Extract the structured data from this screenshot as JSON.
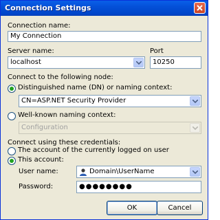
{
  "window": {
    "title": "Connection Settings"
  },
  "connection_name": {
    "label": "Connection name:",
    "value": "My Connection"
  },
  "server": {
    "label": "Server name:",
    "value": "localhost"
  },
  "port": {
    "label": "Port",
    "value": "10250"
  },
  "node": {
    "label": "Connect to the following node:",
    "dn_label": "Distinguished name (DN) or naming context:",
    "dn_value": "CN=ASP.NET Security Provider",
    "wk_label": "Well-known naming context:",
    "wk_value": "Configuration"
  },
  "credentials": {
    "label": "Connect using these credentials:",
    "current_user_label": "The account of the currently logged on user",
    "this_account_label": "This account:",
    "user_name_label": "User name:",
    "user_name_value": "Domain\\UserName",
    "password_label": "Password:",
    "password_value": "●●●●●●●●"
  },
  "buttons": {
    "ok": "OK",
    "cancel": "Cancel"
  },
  "colors": {
    "title_bar": "#0450d8",
    "dialog": "#ece9d8",
    "field_border": "#7f9db9",
    "radio_check": "#21a121"
  }
}
